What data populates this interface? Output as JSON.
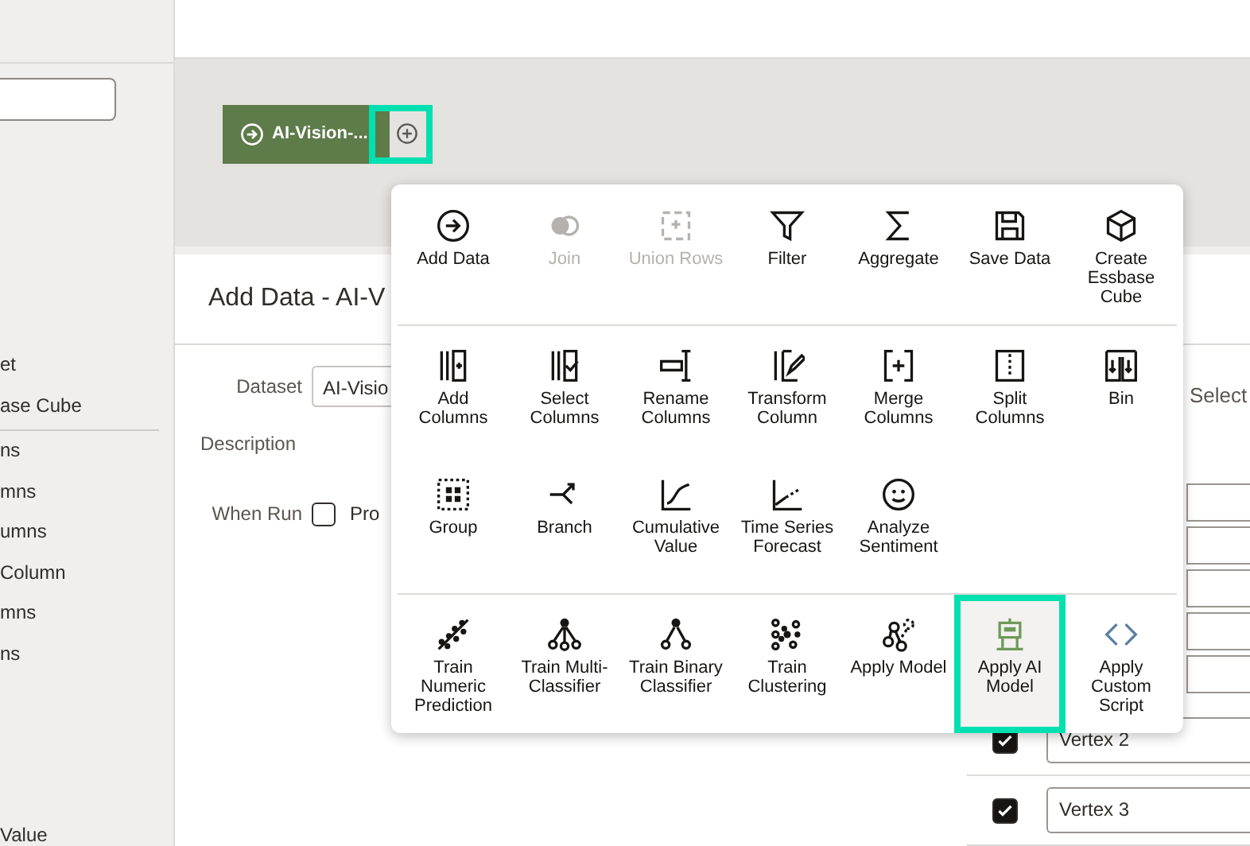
{
  "sidebar": {
    "groups": [
      [
        "et",
        "ase Cube"
      ],
      [
        "ns",
        "mns",
        "umns",
        "Column",
        "mns",
        "ns"
      ],
      [
        "Value"
      ]
    ]
  },
  "flow": {
    "node": {
      "label": "AI-Vision-..."
    },
    "add_step": {
      "selected": true
    }
  },
  "step_menu": {
    "sections": [
      {
        "rows": [
          [
            {
              "label": "Add Data",
              "disabled": false,
              "selected": false
            },
            {
              "label": "Join",
              "disabled": true,
              "selected": false
            },
            {
              "label": "Union Rows",
              "disabled": true,
              "selected": false
            },
            {
              "label": "Filter",
              "disabled": false,
              "selected": false
            },
            {
              "label": "Aggregate",
              "disabled": false,
              "selected": false
            },
            {
              "label": "Save Data",
              "disabled": false,
              "selected": false
            },
            {
              "label": "Create Essbase Cube",
              "disabled": false,
              "selected": false
            }
          ]
        ]
      },
      {
        "rows": [
          [
            {
              "label": "Add Columns",
              "disabled": false,
              "selected": false
            },
            {
              "label": "Select Columns",
              "disabled": false,
              "selected": false
            },
            {
              "label": "Rename Columns",
              "disabled": false,
              "selected": false
            },
            {
              "label": "Transform Column",
              "disabled": false,
              "selected": false
            },
            {
              "label": "Merge Columns",
              "disabled": false,
              "selected": false
            },
            {
              "label": "Split Columns",
              "disabled": false,
              "selected": false
            },
            {
              "label": "Bin",
              "disabled": false,
              "selected": false
            }
          ],
          [
            {
              "label": "Group",
              "disabled": false,
              "selected": false
            },
            {
              "label": "Branch",
              "disabled": false,
              "selected": false
            },
            {
              "label": "Cumulative Value",
              "disabled": false,
              "selected": false
            },
            {
              "label": "Time Series Forecast",
              "disabled": false,
              "selected": false
            },
            {
              "label": "Analyze Sentiment",
              "disabled": false,
              "selected": false
            }
          ]
        ]
      },
      {
        "rows": [
          [
            {
              "label": "Train Numeric Prediction",
              "disabled": false,
              "selected": false
            },
            {
              "label": "Train Multi-Classifier",
              "disabled": false,
              "selected": false
            },
            {
              "label": "Train Binary Classifier",
              "disabled": false,
              "selected": false
            },
            {
              "label": "Train Clustering",
              "disabled": false,
              "selected": false
            },
            {
              "label": "Apply Model",
              "disabled": false,
              "selected": false
            },
            {
              "label": "Apply AI Model",
              "disabled": false,
              "selected": true
            },
            {
              "label": "Apply Custom Script",
              "disabled": false,
              "selected": false
            }
          ]
        ]
      }
    ]
  },
  "editor": {
    "title": "Add Data - AI-V",
    "dataset": {
      "label": "Dataset",
      "value": "AI-Visio"
    },
    "description": {
      "label": "Description"
    },
    "when_run": {
      "label": "When Run",
      "checked": false,
      "option": "Pro"
    },
    "select_label": "Select",
    "vertex_rows": [
      {
        "checked": true,
        "value": "Vertex 2"
      },
      {
        "checked": true,
        "value": "Vertex 3"
      }
    ]
  }
}
